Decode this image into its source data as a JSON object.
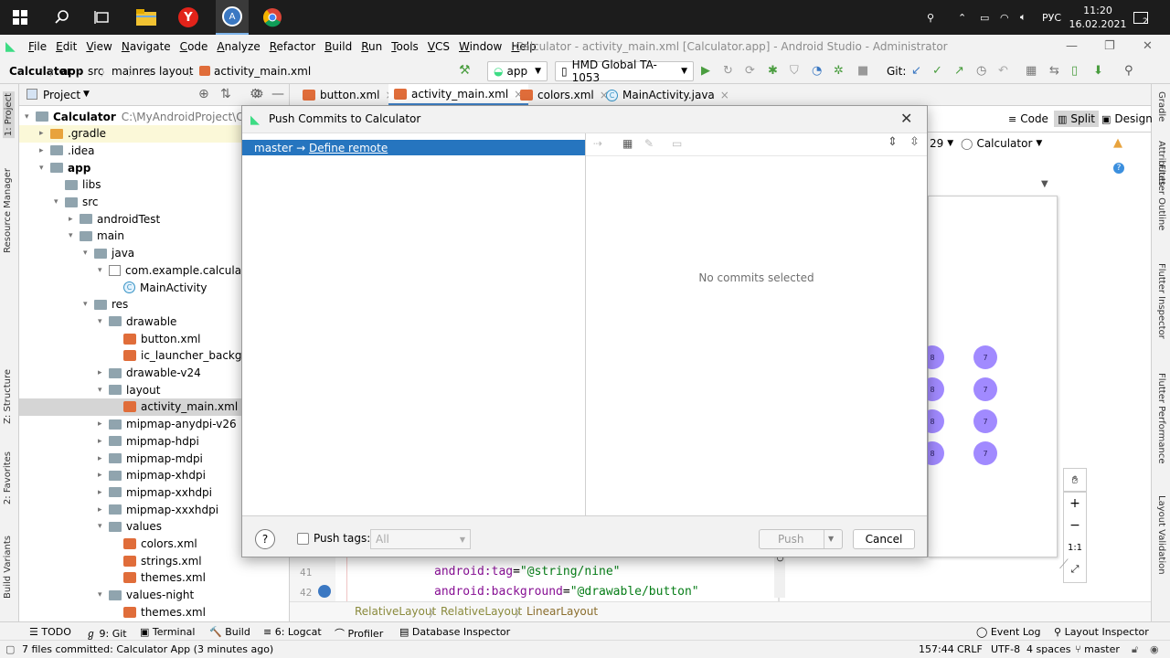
{
  "taskbar": {
    "lang": "РУС",
    "time": "11:20",
    "date": "16.02.2021",
    "notif_count": "2"
  },
  "menu": {
    "items": [
      "File",
      "Edit",
      "View",
      "Navigate",
      "Code",
      "Analyze",
      "Refactor",
      "Build",
      "Run",
      "Tools",
      "VCS",
      "Window",
      "Help"
    ],
    "window_title": "Calculator - activity_main.xml [Calculator.app] - Android Studio - Administrator"
  },
  "nav": {
    "crumbs": [
      "Calculator",
      "app",
      "src",
      "main",
      "res",
      "layout",
      "activity_main.xml"
    ],
    "run_config": "app",
    "device": "HMD Global TA-1053",
    "git_label": "Git:"
  },
  "left_tabs": [
    "1: Project",
    "Resource Manager",
    "Z: Structure",
    "2: Favorites",
    "Build Variants"
  ],
  "right_tabs": [
    "Gradle",
    "Attributes",
    "Flutter Outline",
    "Flutter Inspector",
    "Flutter Performance",
    "Layout Validation"
  ],
  "project": {
    "title": "Project",
    "tree": [
      {
        "label": "Calculator",
        "hint": "C:\\MyAndroidProject\\Calculat",
        "depth": 0,
        "arrow": "▾",
        "icon": "folder",
        "bold": true
      },
      {
        "label": ".gradle",
        "depth": 1,
        "arrow": "▸",
        "icon": "folder-orange",
        "highlight": true
      },
      {
        "label": ".idea",
        "depth": 1,
        "arrow": "▸",
        "icon": "folder"
      },
      {
        "label": "app",
        "depth": 1,
        "arrow": "▾",
        "icon": "folder",
        "bold": true
      },
      {
        "label": "libs",
        "depth": 2,
        "arrow": "",
        "icon": "folder"
      },
      {
        "label": "src",
        "depth": 2,
        "arrow": "▾",
        "icon": "folder"
      },
      {
        "label": "androidTest",
        "depth": 3,
        "arrow": "▸",
        "icon": "folder"
      },
      {
        "label": "main",
        "depth": 3,
        "arrow": "▾",
        "icon": "folder"
      },
      {
        "label": "java",
        "depth": 4,
        "arrow": "▾",
        "icon": "folder"
      },
      {
        "label": "com.example.calculator",
        "depth": 5,
        "arrow": "▾",
        "icon": "package"
      },
      {
        "label": "MainActivity",
        "depth": 6,
        "arrow": "",
        "icon": "java"
      },
      {
        "label": "res",
        "depth": 4,
        "arrow": "▾",
        "icon": "folder"
      },
      {
        "label": "drawable",
        "depth": 5,
        "arrow": "▾",
        "icon": "folder"
      },
      {
        "label": "button.xml",
        "depth": 6,
        "arrow": "",
        "icon": "xml"
      },
      {
        "label": "ic_launcher_backgrou",
        "depth": 6,
        "arrow": "",
        "icon": "xml"
      },
      {
        "label": "drawable-v24",
        "depth": 5,
        "arrow": "▸",
        "icon": "folder"
      },
      {
        "label": "layout",
        "depth": 5,
        "arrow": "▾",
        "icon": "folder"
      },
      {
        "label": "activity_main.xml",
        "depth": 6,
        "arrow": "",
        "icon": "xml",
        "selected": true
      },
      {
        "label": "mipmap-anydpi-v26",
        "depth": 5,
        "arrow": "▸",
        "icon": "folder"
      },
      {
        "label": "mipmap-hdpi",
        "depth": 5,
        "arrow": "▸",
        "icon": "folder"
      },
      {
        "label": "mipmap-mdpi",
        "depth": 5,
        "arrow": "▸",
        "icon": "folder"
      },
      {
        "label": "mipmap-xhdpi",
        "depth": 5,
        "arrow": "▸",
        "icon": "folder"
      },
      {
        "label": "mipmap-xxhdpi",
        "depth": 5,
        "arrow": "▸",
        "icon": "folder"
      },
      {
        "label": "mipmap-xxxhdpi",
        "depth": 5,
        "arrow": "▸",
        "icon": "folder"
      },
      {
        "label": "values",
        "depth": 5,
        "arrow": "▾",
        "icon": "folder"
      },
      {
        "label": "colors.xml",
        "depth": 6,
        "arrow": "",
        "icon": "xml"
      },
      {
        "label": "strings.xml",
        "depth": 6,
        "arrow": "",
        "icon": "xml"
      },
      {
        "label": "themes.xml",
        "depth": 6,
        "arrow": "",
        "icon": "xml"
      },
      {
        "label": "values-night",
        "depth": 5,
        "arrow": "▾",
        "icon": "folder"
      },
      {
        "label": "themes.xml",
        "depth": 6,
        "arrow": "",
        "icon": "xml"
      }
    ]
  },
  "editor": {
    "tabs": [
      {
        "label": "button.xml",
        "icon": "xml"
      },
      {
        "label": "activity_main.xml",
        "icon": "xml",
        "active": true
      },
      {
        "label": "colors.xml",
        "icon": "xml"
      },
      {
        "label": "MainActivity.java",
        "icon": "java"
      }
    ],
    "view_modes": [
      "Code",
      "Split",
      "Design"
    ],
    "api_level": "29",
    "theme": "Calculator",
    "code_lines": [
      {
        "num": "41",
        "attr": "android:tag",
        "value": "\"@string/nine\""
      },
      {
        "num": "42",
        "attr": "android:background",
        "value": "\"@drawable/button\""
      }
    ],
    "breadcrumb": [
      "RelativeLayout",
      "RelativeLayout",
      "LinearLayout"
    ],
    "preview_buttons": [
      "8",
      "7",
      "8",
      "7",
      "8",
      "7",
      "8",
      "7"
    ],
    "zoom_labels": [
      "+",
      "−",
      "1:1"
    ]
  },
  "dialog": {
    "title": "Push Commits to Calculator",
    "branch": "master",
    "arrow": "→",
    "define_remote": "Define remote",
    "empty_text": "No commits selected",
    "help": "?",
    "push_tags_label": "Push tags:",
    "push_tags_value": "All",
    "push_label": "Push",
    "cancel_label": "Cancel"
  },
  "bottom_tools": [
    {
      "label": "TODO",
      "prefix": "☰"
    },
    {
      "label": "9: Git",
      "prefix": "ℊ"
    },
    {
      "label": "Terminal",
      "prefix": "▣"
    },
    {
      "label": "Build",
      "prefix": "🔨"
    },
    {
      "label": "6: Logcat",
      "prefix": "≡"
    },
    {
      "label": "Profiler",
      "prefix": "⌒"
    },
    {
      "label": "Database Inspector",
      "prefix": "▤"
    }
  ],
  "right_tools": [
    {
      "label": "Event Log"
    },
    {
      "label": "Layout Inspector"
    }
  ],
  "statusbar": {
    "message": "7 files committed: Calculator App (3 minutes ago)",
    "position": "157:44",
    "line_sep": "CRLF",
    "encoding": "UTF-8",
    "indent": "4 spaces",
    "branch": "master"
  }
}
